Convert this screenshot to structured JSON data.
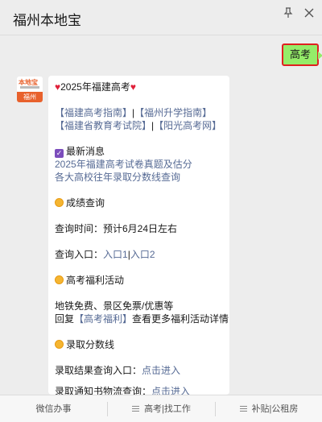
{
  "header": {
    "title": "福州本地宝",
    "pin_icon": "pin-icon",
    "close_icon": "close-icon"
  },
  "sent_message": {
    "text": "高考"
  },
  "avatar": {
    "brand_top": "本地宝",
    "brand_bottom": "福州"
  },
  "reply": {
    "heading": "2025年福建高考",
    "links_row1": [
      "【福建高考指南】",
      "|",
      "【福州升学指南】"
    ],
    "links_row2": [
      "【福建省教育考试院】",
      "|",
      "【阳光高考网】"
    ],
    "latest": {
      "label": "最新消息",
      "items": [
        "2025年福建高考试卷真题及估分",
        "各大高校往年录取分数线查询"
      ]
    },
    "score": {
      "label": "成绩查询",
      "time_label": "查询时间：预计6月24日左右",
      "entry_prefix": "查询入口：",
      "entry1": "入口1",
      "entry_sep": "|",
      "entry2": "入口2"
    },
    "welfare": {
      "label": "高考福利活动",
      "desc": "地铁免费、景区免票/优惠等",
      "reply_prefix": "回复",
      "reply_link": "【高考福利】",
      "reply_suffix": "查看更多福利活动详情"
    },
    "admission": {
      "label": "录取分数线",
      "query_prefix": "录取结果查询入口：",
      "query_link": "点击进入",
      "notice_prefix": "录取通知书物流查询：",
      "notice_link": "点击进入"
    }
  },
  "tabbar": {
    "tabs": [
      "微信办事",
      "高考|找工作",
      "补贴|公租房"
    ]
  },
  "colors": {
    "accent_link": "#576b95",
    "sent_bubble": "#95ec69",
    "highlight_border": "#e02020"
  }
}
